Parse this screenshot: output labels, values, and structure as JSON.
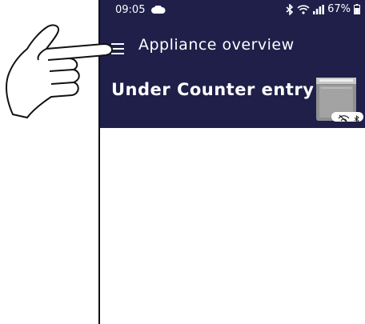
{
  "status_bar": {
    "time": "09:05",
    "battery": "67%"
  },
  "app_bar": {
    "title": "Appliance overview"
  },
  "appliance": {
    "name": "Under Counter entry"
  },
  "colors": {
    "header_bg": "#1f1f4a",
    "accent": "#ffffff"
  },
  "icons": [
    "cloud-icon",
    "bluetooth-icon",
    "wifi-icon",
    "signal-icon",
    "battery-icon",
    "menu-icon",
    "appliance-image",
    "wifi-off-icon",
    "pointing-hand-icon"
  ]
}
